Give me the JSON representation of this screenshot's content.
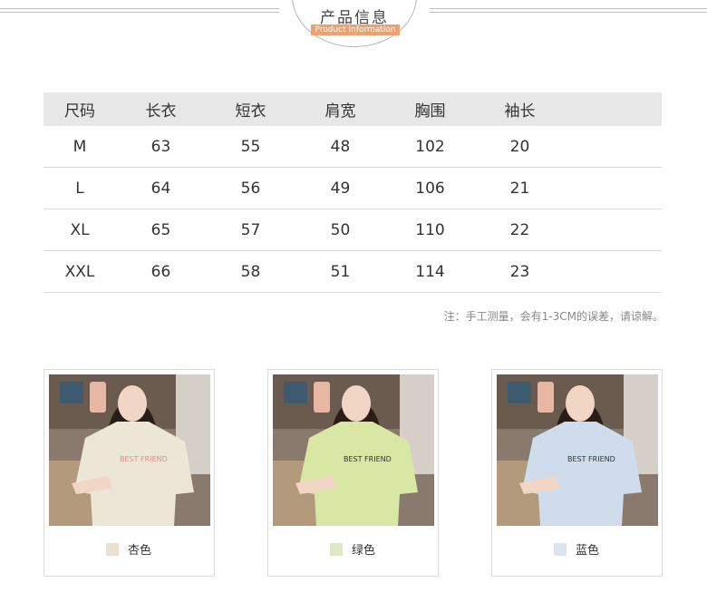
{
  "header": {
    "title": "产品信息",
    "subtitle": "Product Information"
  },
  "size_table": {
    "columns": [
      "尺码",
      "长衣",
      "短衣",
      "肩宽",
      "胸围",
      "袖长"
    ],
    "rows": [
      [
        "M",
        "63",
        "55",
        "48",
        "102",
        "20"
      ],
      [
        "L",
        "64",
        "56",
        "49",
        "106",
        "21"
      ],
      [
        "XL",
        "65",
        "57",
        "50",
        "110",
        "22"
      ],
      [
        "XXL",
        "66",
        "58",
        "51",
        "114",
        "23"
      ]
    ],
    "note": "注：手工测量，会有1-3CM的误差，请谅解。"
  },
  "colors": [
    {
      "label": "杏色",
      "swatch": "#e8e0d0",
      "shirt": "#ece6d6",
      "text_color": "#e98a8a"
    },
    {
      "label": "绿色",
      "swatch": "#dce9c2",
      "shirt": "#d8e7a3",
      "text_color": "#333333"
    },
    {
      "label": "蓝色",
      "swatch": "#dbe5ee",
      "shirt": "#cfdcec",
      "text_color": "#333333"
    }
  ]
}
